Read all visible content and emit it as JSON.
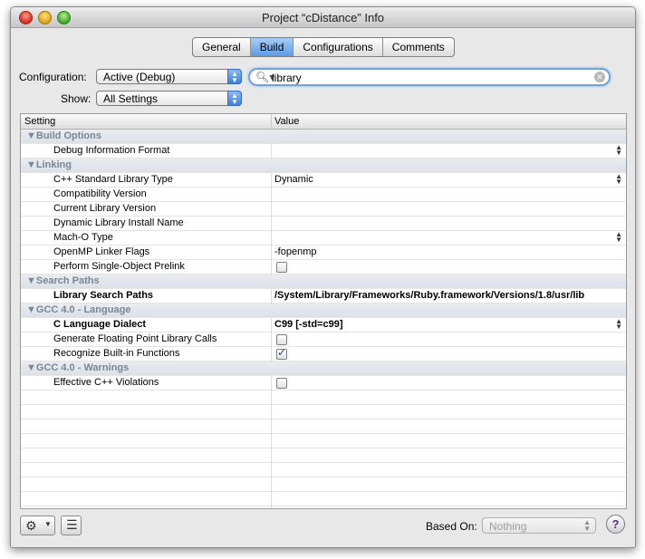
{
  "window": {
    "title": "Project “cDistance” Info"
  },
  "tabs": [
    "General",
    "Build",
    "Configurations",
    "Comments"
  ],
  "active_tab": "Build",
  "configuration": {
    "label": "Configuration:",
    "value": "Active (Debug)"
  },
  "show": {
    "label": "Show:",
    "value": "All Settings"
  },
  "search": {
    "value": "library"
  },
  "table": {
    "headers": {
      "setting": "Setting",
      "value": "Value"
    },
    "rows": [
      {
        "type": "group",
        "name": "▼Build Options"
      },
      {
        "type": "item",
        "name": "Debug Information Format",
        "value": "",
        "control": "stepper"
      },
      {
        "type": "group",
        "name": "▼Linking"
      },
      {
        "type": "item",
        "name": "C++ Standard Library Type",
        "value": "Dynamic",
        "control": "stepper"
      },
      {
        "type": "item",
        "name": "Compatibility Version",
        "value": ""
      },
      {
        "type": "item",
        "name": "Current Library Version",
        "value": ""
      },
      {
        "type": "item",
        "name": "Dynamic Library Install Name",
        "value": ""
      },
      {
        "type": "item",
        "name": "Mach-O Type",
        "value": "",
        "control": "stepper"
      },
      {
        "type": "item",
        "name": "OpenMP Linker Flags",
        "value": "-fopenmp"
      },
      {
        "type": "item",
        "name": "Perform Single-Object Prelink",
        "control": "checkbox",
        "checked": false
      },
      {
        "type": "group",
        "name": "▼Search Paths"
      },
      {
        "type": "item",
        "name": "Library Search Paths",
        "value": "/System/Library/Frameworks/Ruby.framework/Versions/1.8/usr/lib",
        "bold": true
      },
      {
        "type": "group",
        "name": "▼GCC 4.0 - Language"
      },
      {
        "type": "item",
        "name": "C Language Dialect",
        "value": "C99 [-std=c99]",
        "bold": true,
        "control": "stepper"
      },
      {
        "type": "item",
        "name": "Generate Floating Point Library Calls",
        "control": "checkbox",
        "checked": false
      },
      {
        "type": "item",
        "name": "Recognize Built-in Functions",
        "control": "checkbox",
        "checked": true
      },
      {
        "type": "group",
        "name": "▼GCC 4.0 - Warnings"
      },
      {
        "type": "item",
        "name": "Effective C++ Violations",
        "control": "checkbox",
        "checked": false
      }
    ],
    "empty_rows": 8
  },
  "footer": {
    "based_on_label": "Based On:",
    "based_on_value": "Nothing",
    "help": "?"
  },
  "icons": [
    "gear-icon",
    "chevron-down-icon",
    "list-icon",
    "search-icon",
    "clear-icon",
    "help-icon"
  ]
}
